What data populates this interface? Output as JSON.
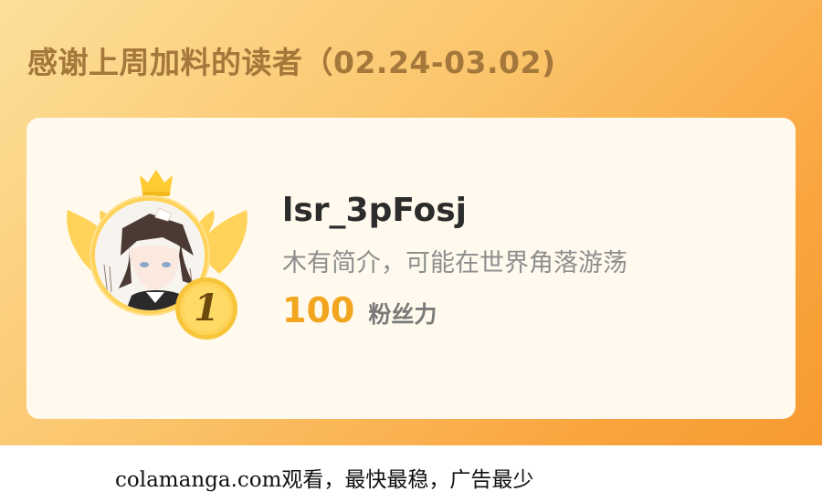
{
  "banner": {
    "title": "感谢上周加料的读者（02.24-03.02)"
  },
  "reader": {
    "rank": "1",
    "username": "lsr_3pFosj",
    "bio": "木有简介，可能在世界角落游荡",
    "fans_value": "100",
    "fans_label": "粉丝力"
  },
  "footer": {
    "text": "colamanga.com观看，最快最稳，广告最少"
  },
  "icons": {
    "crown": "crown-icon",
    "wings": "wings-icon",
    "rank_badge": "rank-badge-icon"
  },
  "colors": {
    "banner_accent": "#f9a53f",
    "title": "#a4773a",
    "fans_number": "#f2a51e",
    "gold": "#ffd35a"
  }
}
